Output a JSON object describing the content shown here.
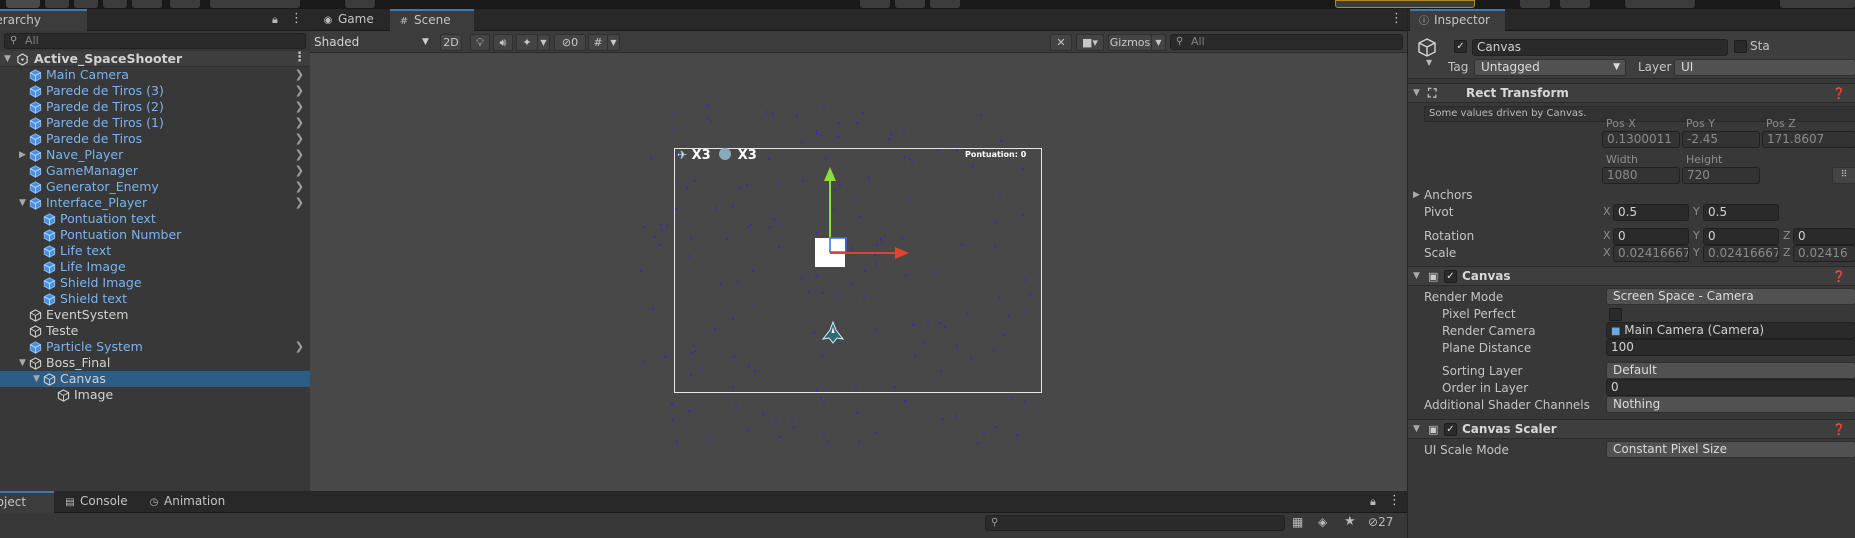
{
  "hierarchy": {
    "tab_label": "Hierarchy",
    "tab_visible": "ierarchy",
    "search_placeholder": "All",
    "scene_name": "Active_SpaceShooter",
    "items": [
      {
        "label": "Main Camera",
        "color": "blue",
        "indent": 1,
        "expand": "",
        "arrow": true
      },
      {
        "label": "Parede de Tiros (3)",
        "color": "blue",
        "indent": 1,
        "expand": "",
        "arrow": true
      },
      {
        "label": "Parede de Tiros (2)",
        "color": "blue",
        "indent": 1,
        "expand": "",
        "arrow": true
      },
      {
        "label": "Parede de Tiros (1)",
        "color": "blue",
        "indent": 1,
        "expand": "",
        "arrow": true
      },
      {
        "label": "Parede de Tiros",
        "color": "blue",
        "indent": 1,
        "expand": "",
        "arrow": true
      },
      {
        "label": "Nave_Player",
        "color": "blue",
        "indent": 1,
        "expand": "collapsed",
        "arrow": true
      },
      {
        "label": "GameManager",
        "color": "blue",
        "indent": 1,
        "expand": "",
        "arrow": true
      },
      {
        "label": "Generator_Enemy",
        "color": "blue",
        "indent": 1,
        "expand": "",
        "arrow": true
      },
      {
        "label": "Interface_Player",
        "color": "blue",
        "indent": 1,
        "expand": "expanded",
        "arrow": true
      },
      {
        "label": "Pontuation text",
        "color": "blue",
        "indent": 2,
        "expand": "",
        "arrow": false
      },
      {
        "label": "Pontuation Number",
        "color": "blue",
        "indent": 2,
        "expand": "",
        "arrow": false
      },
      {
        "label": "Life text",
        "color": "blue",
        "indent": 2,
        "expand": "",
        "arrow": false
      },
      {
        "label": "Life Image",
        "color": "blue",
        "indent": 2,
        "expand": "",
        "arrow": false
      },
      {
        "label": "Shield Image",
        "color": "blue",
        "indent": 2,
        "expand": "",
        "arrow": false
      },
      {
        "label": "Shield text",
        "color": "blue",
        "indent": 2,
        "expand": "",
        "arrow": false
      },
      {
        "label": "EventSystem",
        "color": "white",
        "indent": 1,
        "expand": "",
        "arrow": false
      },
      {
        "label": "Teste",
        "color": "white",
        "indent": 1,
        "expand": "",
        "arrow": false
      },
      {
        "label": "Particle System",
        "color": "blue",
        "indent": 1,
        "expand": "",
        "arrow": true
      },
      {
        "label": "Boss_Final",
        "color": "white",
        "indent": 1,
        "expand": "expanded",
        "arrow": false
      },
      {
        "label": "Canvas",
        "color": "white",
        "indent": 2,
        "expand": "expanded",
        "arrow": false,
        "selected": true
      },
      {
        "label": "Image",
        "color": "white",
        "indent": 3,
        "expand": "",
        "arrow": false
      }
    ]
  },
  "scene": {
    "tabs": [
      {
        "label": "Game",
        "icon": "gamepad"
      },
      {
        "label": "Scene",
        "icon": "grid"
      }
    ],
    "shading_mode": "Shaded",
    "btn_2d": "2D",
    "hidden_count": "0",
    "gizmos_label": "Gizmos",
    "search_placeholder": "All",
    "game_ui": {
      "lives": "X3",
      "shields": "X3",
      "pontuation": "Pontuation: 0"
    }
  },
  "bottom": {
    "tabs": [
      {
        "label": "Project",
        "visible": "roject"
      },
      {
        "label": "Console"
      },
      {
        "label": "Animation"
      }
    ],
    "hidden_count": "27"
  },
  "inspector": {
    "tab_label": "Inspector",
    "object_name": "Canvas",
    "static_label": "Static",
    "static_visible": "Sta",
    "tag_label": "Tag",
    "tag_value": "Untagged",
    "layer_label": "Layer",
    "layer_value": "UI",
    "rect_transform": {
      "title": "Rect Transform",
      "note": "Some values driven by Canvas.",
      "posx_label": "Pos X",
      "posx": "0.1300011",
      "posy_label": "Pos Y",
      "posy": "-2.45",
      "posz_label": "Pos Z",
      "posz": "171.8607",
      "width_label": "Width",
      "width": "1080",
      "height_label": "Height",
      "height": "720",
      "anchors": "Anchors",
      "pivot": "Pivot",
      "pivot_x": "0.5",
      "pivot_y": "0.5",
      "rotation": "Rotation",
      "rot_x": "0",
      "rot_y": "0",
      "rot_z": "0",
      "scale": "Scale",
      "scale_x": "0.02416667",
      "scale_y": "0.02416667",
      "scale_z": "0.02416"
    },
    "canvas": {
      "title": "Canvas",
      "render_mode_label": "Render Mode",
      "render_mode": "Screen Space - Camera",
      "pixel_perfect_label": "Pixel Perfect",
      "render_camera_label": "Render Camera",
      "render_camera": "Main Camera (Camera)",
      "plane_distance_label": "Plane Distance",
      "plane_distance": "100",
      "sorting_layer_label": "Sorting Layer",
      "sorting_layer": "Default",
      "order_label": "Order in Layer",
      "order": "0",
      "shader_channels_label": "Additional Shader Channels",
      "shader_channels": "Nothing"
    },
    "canvas_scaler": {
      "title": "Canvas Scaler",
      "ui_scale_mode_label": "UI Scale Mode",
      "ui_scale_mode": "Constant Pixel Size"
    }
  },
  "colors": {
    "accent": "#3a79bb",
    "selection": "#2c5d87",
    "prefab_blue": "#7cb3f0"
  }
}
